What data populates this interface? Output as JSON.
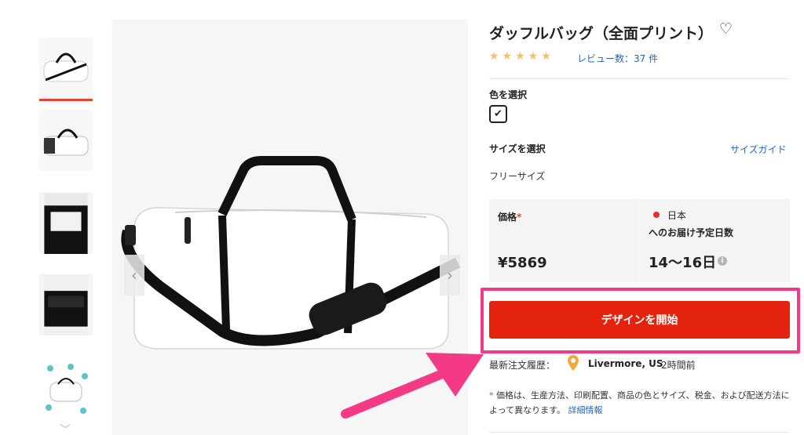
{
  "product": {
    "title": "ダッフルバッグ（全面プリント）",
    "rating_stars": "★★★★★",
    "reviews": "レビュー数：37 件"
  },
  "color": {
    "label": "色を選択",
    "selected_icon": "check-icon"
  },
  "size": {
    "label": "サイズを選択",
    "guide_link": "サイズガイド",
    "value": "フリーサイズ"
  },
  "price": {
    "label": "価格",
    "required_mark": "*",
    "value": "¥5869"
  },
  "shipping": {
    "country": "日本",
    "label": "へのお届け予定日数",
    "days": "14〜16日",
    "info_icon": "i"
  },
  "cta": {
    "label": "デザインを開始"
  },
  "recent_order": {
    "label": "最新注文履歴：",
    "city": "Livermore, US",
    "time": "2時間前"
  },
  "note": {
    "mark": "*",
    "text": "価格は、生産方法、印刷配置、商品の色とサイズ、税金、および配送方法によって異なります。",
    "link": "詳細情報"
  },
  "gallery": {
    "prev_arrow": "‹",
    "next_arrow": "›",
    "thumb_up": "︿",
    "thumb_down": "﹀"
  },
  "colors": {
    "accent_red": "#e4230e",
    "highlight_pink": "#f43a87",
    "link_blue": "#2867b2",
    "star_gold": "#f0c06a"
  }
}
